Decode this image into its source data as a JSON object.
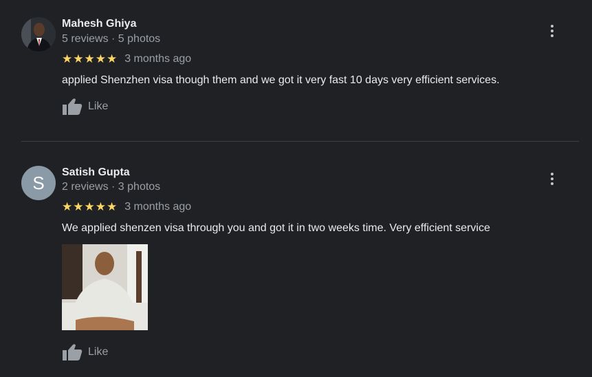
{
  "reviews": [
    {
      "name": "Mahesh Ghiya",
      "meta": "5 reviews · 5 photos",
      "stars": "★★★★★",
      "rating": 5,
      "time": "3 months ago",
      "text": "applied Shenzhen visa though them and we got it very fast 10 days very efficient services.",
      "like_label": "Like"
    },
    {
      "name": "Satish Gupta",
      "avatar_letter": "S",
      "meta": "2 reviews · 3 photos",
      "stars": "★★★★★",
      "rating": 5,
      "time": "3 months ago",
      "text": "We applied shenzen visa through you and got it in two weeks time. Very efficient service",
      "like_label": "Like"
    }
  ],
  "colors": {
    "background": "#202124",
    "star": "#fdd663",
    "avatar_letter_bg": "#8a9aa6"
  }
}
